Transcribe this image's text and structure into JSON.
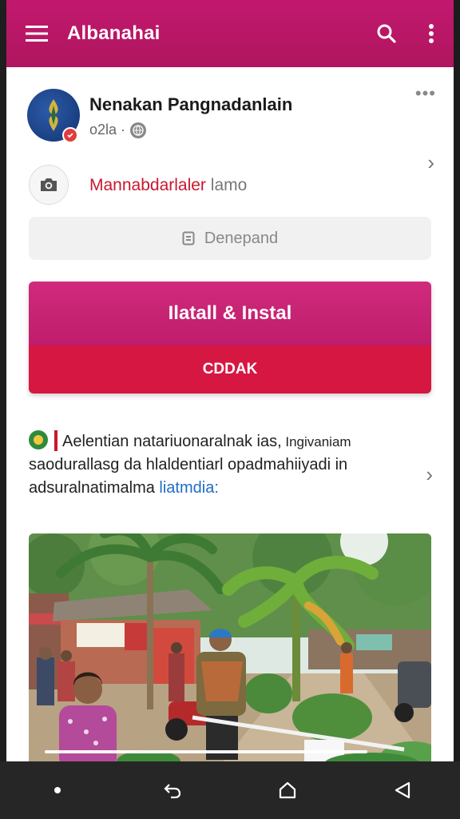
{
  "appbar": {
    "title": "Albanahai",
    "menu_icon": "menu-icon",
    "search_icon": "search-icon",
    "overflow_icon": "more-vertical-icon",
    "color": "#c2186e"
  },
  "profile": {
    "name": "Nenakan Pangnadanlain",
    "meta": "o2la ·",
    "more_label": "•••"
  },
  "post_as": {
    "red_text": "Mannabdarlaler",
    "grey_text": " lamo"
  },
  "demand_input": {
    "placeholder": "Denepand"
  },
  "buttons": {
    "install_label": "Ilatall & Instal",
    "cdak_label": "CDDAK",
    "install_color": "#c51f71",
    "cdak_color": "#d61741"
  },
  "announcement": {
    "line1": "Aelentian natariuonaralnak ias,",
    "line1_small": " Ingivaniam",
    "line2": "saodurallasg da hlaldentiarl opadmahiiyadi in",
    "line3": "adsuralnatimalma ",
    "link_text": "liatmdia:"
  },
  "photo": {
    "progress": 0.8
  },
  "navbar": {
    "buttons": [
      "recents-dot-icon",
      "back-arrow-icon",
      "home-icon",
      "back-triangle-icon"
    ]
  }
}
